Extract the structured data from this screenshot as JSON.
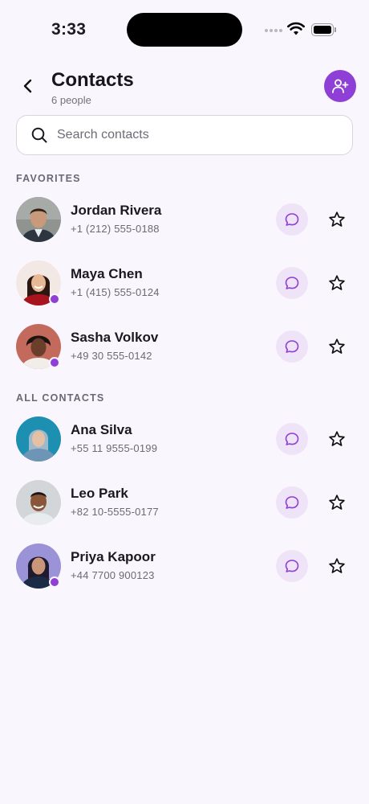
{
  "status_bar": {
    "time": "3:33"
  },
  "header": {
    "title": "Contacts",
    "subtitle": "6 people"
  },
  "search": {
    "placeholder": "Search contacts",
    "value": ""
  },
  "sections": {
    "favorites": {
      "label": "FAVORITES",
      "contacts": [
        {
          "name": "Jordan Rivera",
          "phone": "+1 (212) 555-0188",
          "online": false,
          "favorite": false
        },
        {
          "name": "Maya Chen",
          "phone": "+1 (415) 555-0124",
          "online": true,
          "favorite": false
        },
        {
          "name": "Sasha Volkov",
          "phone": "+49 30 555-0142",
          "online": true,
          "favorite": false
        }
      ]
    },
    "all": {
      "label": "ALL CONTACTS",
      "contacts": [
        {
          "name": "Ana Silva",
          "phone": "+55 11 9555-0199",
          "online": false,
          "favorite": false
        },
        {
          "name": "Leo Park",
          "phone": "+82 10-5555-0177",
          "online": false,
          "favorite": false
        },
        {
          "name": "Priya Kapoor",
          "phone": "+44 7700 900123",
          "online": true,
          "favorite": false
        }
      ]
    }
  },
  "colors": {
    "accent": "#8d3fd6",
    "accent_soft": "#efe3f8",
    "background": "#faf6fd"
  },
  "icons": {
    "back": "chevron-left-icon",
    "add": "add-user-icon",
    "search": "search-icon",
    "message": "message-icon",
    "star": "star-outline-icon"
  }
}
